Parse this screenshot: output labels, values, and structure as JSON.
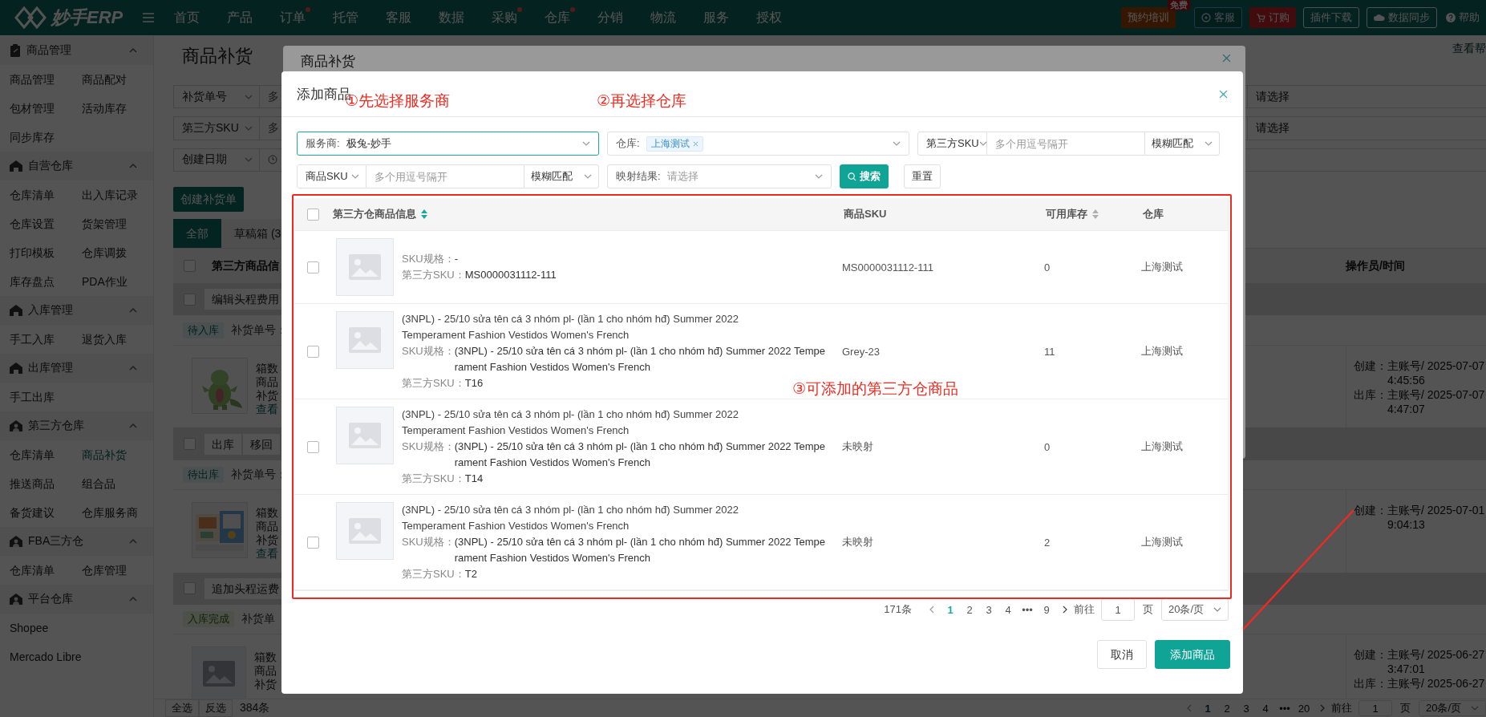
{
  "top_nav": {
    "logo": "妙手ERP",
    "items": [
      {
        "label": "首页",
        "dot": false
      },
      {
        "label": "产品",
        "dot": false
      },
      {
        "label": "订单",
        "dot": true
      },
      {
        "label": "托管",
        "dot": false
      },
      {
        "label": "客服",
        "dot": false
      },
      {
        "label": "数据",
        "dot": false
      },
      {
        "label": "采购",
        "dot": true
      },
      {
        "label": "仓库",
        "dot": true
      },
      {
        "label": "分销",
        "dot": false
      },
      {
        "label": "物流",
        "dot": false
      },
      {
        "label": "服务",
        "dot": false
      },
      {
        "label": "授权",
        "dot": false
      }
    ],
    "actions": [
      {
        "kind": "training",
        "label": "预约培训",
        "badge": "免费"
      },
      {
        "kind": "service",
        "label": "客服"
      },
      {
        "kind": "order",
        "label": "订购"
      },
      {
        "kind": "plain",
        "label": "插件下载"
      },
      {
        "kind": "sync",
        "label": "数据同步"
      },
      {
        "kind": "help",
        "label": "帮助"
      }
    ]
  },
  "sidebar": {
    "groups": [
      {
        "title": "商品管理",
        "kind": "goods",
        "two_columns": true,
        "expanded": true,
        "items": [
          {
            "label": "商品管理",
            "selected": false
          },
          {
            "label": "商品配对",
            "selected": false
          },
          {
            "label": "包材管理",
            "selected": false
          },
          {
            "label": "活动库存",
            "selected": false
          },
          {
            "label": "同步库存",
            "selected": false
          }
        ]
      },
      {
        "title": "自营仓库",
        "kind": "warehouse",
        "two_columns": true,
        "expanded": true,
        "items": [
          {
            "label": "仓库清单",
            "selected": false
          },
          {
            "label": "出入库记录",
            "selected": false
          },
          {
            "label": "仓库设置",
            "selected": false
          },
          {
            "label": "货架管理",
            "selected": false
          },
          {
            "label": "打印模板",
            "selected": false
          },
          {
            "label": "仓库调拨",
            "selected": false
          },
          {
            "label": "库存盘点",
            "selected": false
          },
          {
            "label": "PDA作业",
            "selected": false
          }
        ]
      },
      {
        "title": "入库管理",
        "kind": "warehouse",
        "two_columns": true,
        "expanded": true,
        "items": [
          {
            "label": "手工入库",
            "selected": false
          },
          {
            "label": "退货入库",
            "selected": false
          }
        ]
      },
      {
        "title": "出库管理",
        "kind": "warehouse",
        "two_columns": true,
        "expanded": true,
        "items": [
          {
            "label": "手工出库",
            "selected": false
          }
        ]
      },
      {
        "title": "第三方仓库",
        "kind": "partner",
        "two_columns": true,
        "expanded": true,
        "items": [
          {
            "label": "仓库清单",
            "selected": false
          },
          {
            "label": "商品补货",
            "selected": true
          },
          {
            "label": "推送商品",
            "selected": false
          },
          {
            "label": "组合品",
            "selected": false
          },
          {
            "label": "备货建议",
            "selected": false
          },
          {
            "label": "仓库服务商",
            "selected": false
          }
        ]
      },
      {
        "title": "FBA三方仓",
        "kind": "partner",
        "two_columns": true,
        "expanded": true,
        "items": [
          {
            "label": "仓库清单",
            "selected": false
          },
          {
            "label": "仓库管理",
            "selected": false
          }
        ]
      },
      {
        "title": "平台仓库",
        "kind": "partner",
        "two_columns": false,
        "expanded": true,
        "items": [
          {
            "label": "Shopee",
            "selected": false
          },
          {
            "label": "Mercado Libre",
            "selected": false
          }
        ]
      }
    ]
  },
  "page": {
    "title": "商品补货",
    "help_link": "查看帮",
    "filters": [
      {
        "field": "补货单号",
        "kind": "text",
        "input": "多",
        "right": "请选择"
      },
      {
        "field": "第三方SKU",
        "kind": "text",
        "input": "多",
        "right": "请选择"
      },
      {
        "field": "创建日期",
        "kind": "date"
      }
    ],
    "create_button": "创建补货单",
    "tabs": [
      {
        "label": "全部",
        "selected": true
      },
      {
        "label": "草稿箱 (3",
        "selected": false
      }
    ],
    "table": {
      "columns": [
        "第三方商品信",
        "操作员/时间"
      ],
      "select_all": {
        "checked": false
      },
      "groups": [
        {
          "checked": false,
          "actions": [
            "编辑头程费用"
          ],
          "status": {
            "label": "待入库",
            "kind": "pending"
          },
          "order_label": "补货单号：",
          "photo": true,
          "info": [
            "箱数",
            "商品",
            "补货"
          ],
          "link": "查看",
          "operator": [
            {
              "label": "创建：",
              "value": "主账号/ 2025-07-07 4:45:56"
            },
            {
              "label": "出库：",
              "value": "主账号/ 2025-07-07 4:47:07"
            }
          ]
        },
        {
          "checked": false,
          "actions": [
            "出库",
            "移回"
          ],
          "status": {
            "label": "待出库",
            "kind": "pending"
          },
          "order_label": "补货单号：",
          "photo": true,
          "info": [
            "箱数",
            "商品",
            "补货"
          ],
          "link": "查看",
          "operator": [
            {
              "label": "创建：",
              "value": "主账号/ 2025-07-01 9:04:13"
            }
          ]
        },
        {
          "checked": false,
          "actions": [
            "追加头程运费"
          ],
          "status": {
            "label": "入库完成",
            "kind": "done"
          },
          "order_label": "补货单",
          "photo": false,
          "info": [
            "箱数",
            "商品",
            "补货"
          ],
          "operator": [
            {
              "label": "创建：",
              "value": "主账号/ 2025-06-27 3:47:01"
            },
            {
              "label": "出库：",
              "value": "主账号/ 2025-06-27"
            }
          ]
        }
      ]
    },
    "footer": {
      "buttons": [
        "全选",
        "反选"
      ],
      "count": "384条",
      "pages": [
        {
          "label": "1",
          "selected": true
        },
        {
          "label": "2",
          "selected": false
        },
        {
          "label": "3",
          "selected": false
        },
        {
          "label": "4",
          "selected": false
        },
        {
          "label": "•••",
          "selected": false
        },
        {
          "label": "20",
          "selected": false
        }
      ],
      "goto": "前往",
      "goto_value": "1",
      "page_unit": "页",
      "page_size": "20条/页"
    }
  },
  "back_modal": {
    "title": "商品补货"
  },
  "modal": {
    "title": "添加商品",
    "filter_rows": [
      [
        {
          "kind": "select",
          "label": "服务商:",
          "value": "极兔-妙手",
          "focused": true
        },
        {
          "kind": "tags",
          "label": "仓库:",
          "tags": [
            "上海测试"
          ]
        },
        {
          "kind": "search",
          "field": "第三方SKU",
          "placeholder": "多个用逗号隔开",
          "match": "模糊匹配"
        }
      ],
      [
        {
          "kind": "search",
          "field": "商品SKU",
          "placeholder": "多个用逗号隔开",
          "match": "模糊匹配"
        },
        {
          "kind": "select",
          "label": "映射结果:",
          "placeholder": "请选择",
          "focused": false
        },
        {
          "kind": "button",
          "label": "搜索",
          "primary": true
        },
        {
          "kind": "button",
          "label": "重置",
          "primary": false
        }
      ]
    ],
    "table": {
      "select_all": {
        "checked": false
      },
      "columns": [
        {
          "label": "第三方仓商品信息",
          "sortable": true,
          "sort_active": true
        },
        {
          "label": "商品SKU"
        },
        {
          "label": "可用库存",
          "sortable": true,
          "sort_active": false
        },
        {
          "label": "仓库"
        }
      ],
      "rows": [
        {
          "checked": false,
          "spec_label": "SKU规格：",
          "spec": "-",
          "third_sku_label": "第三方SKU：",
          "third_sku": "MS0000031112-111",
          "sku": "MS0000031112-111",
          "stock": "0",
          "warehouse": "上海测试"
        },
        {
          "checked": false,
          "title": "(3NPL) - 25/10 sửa tên cá 3 nhóm pl- (lần 1 cho nhóm hđ) Summer 2022 Temperament Fashion Vestidos Women's French",
          "spec_label": "SKU规格：",
          "spec": "(3NPL) - 25/10 sửa tên cá 3 nhóm pl- (lần 1 cho nhóm hđ) Summer 2022 Temperament Fashion Vestidos Women's French",
          "third_sku_label": "第三方SKU：",
          "third_sku": "T16",
          "sku": "Grey-23",
          "stock": "11",
          "warehouse": "上海测试"
        },
        {
          "checked": false,
          "title": "(3NPL) - 25/10 sửa tên cá 3 nhóm pl- (lần 1 cho nhóm hđ) Summer 2022 Temperament Fashion Vestidos Women's French",
          "spec_label": "SKU规格：",
          "spec": "(3NPL) - 25/10 sửa tên cá 3 nhóm pl- (lần 1 cho nhóm hđ) Summer 2022 Temperament Fashion Vestidos Women's French",
          "third_sku_label": "第三方SKU：",
          "third_sku": "T14",
          "sku": "未映射",
          "stock": "0",
          "warehouse": "上海测试"
        },
        {
          "checked": false,
          "title": "(3NPL) - 25/10 sửa tên cá 3 nhóm pl- (lần 1 cho nhóm hđ) Summer 2022 Temperament Fashion Vestidos Women's French",
          "spec_label": "SKU规格：",
          "spec": "(3NPL) - 25/10 sửa tên cá 3 nhóm pl- (lần 1 cho nhóm hđ) Summer 2022 Temperament Fashion Vestidos Women's French",
          "third_sku_label": "第三方SKU：",
          "third_sku": "T2",
          "sku": "未映射",
          "stock": "2",
          "warehouse": "上海测试"
        }
      ]
    },
    "pagination": {
      "total": "171条",
      "pages": [
        {
          "label": "1",
          "selected": true
        },
        {
          "label": "2",
          "selected": false
        },
        {
          "label": "3",
          "selected": false
        },
        {
          "label": "4",
          "selected": false
        },
        {
          "label": "•••",
          "selected": false
        },
        {
          "label": "9",
          "selected": false
        }
      ],
      "goto": "前往",
      "goto_value": "1",
      "page_unit": "页",
      "page_size": "20条/页"
    },
    "buttons": [
      {
        "label": "取消",
        "primary": false
      },
      {
        "label": "添加商品",
        "primary": true
      }
    ]
  },
  "annotations": [
    {
      "kind": "note",
      "text": "①先选择服务商"
    },
    {
      "kind": "note",
      "text": "②再选择仓库"
    },
    {
      "kind": "note",
      "text": "③可添加的第三方仓商品"
    },
    {
      "kind": "frame"
    },
    {
      "kind": "arrow"
    }
  ]
}
